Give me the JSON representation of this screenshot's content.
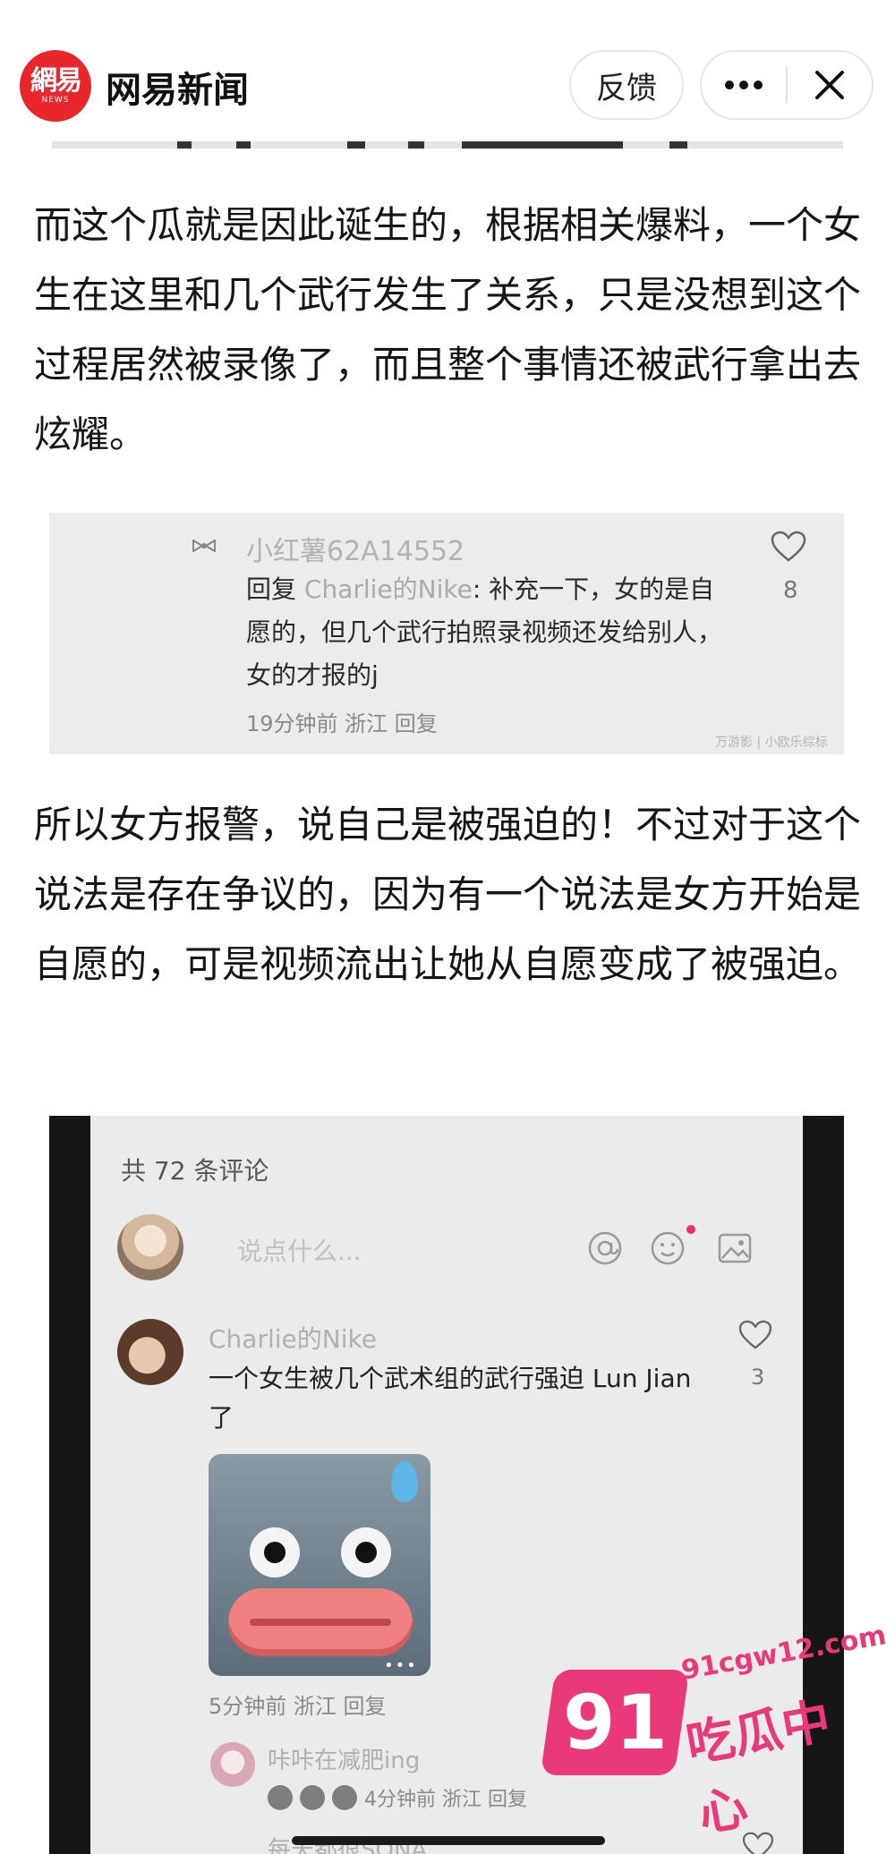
{
  "header": {
    "logo_text": "網易",
    "logo_sub": "NEWS",
    "app_title": "网易新闻",
    "feedback_label": "反馈",
    "more_icon": "more-dots-icon",
    "close_icon": "close-icon"
  },
  "article": {
    "paragraph_1": "而这个瓜就是因此诞生的，根据相关爆料，一个女生在这里和几个武行发生了关系，只是没想到这个过程居然被录像了，而且整个事情还被武行拿出去炫耀。",
    "paragraph_2": "所以女方报警，说自己是被强迫的！不过对于这个说法是存在争议的，因为有一个说法是女方开始是自愿的，可是视频流出让她从自愿变成了被强迫。"
  },
  "screenshot_reply": {
    "tie_icon": "bow-tie-icon",
    "username": "小红薯62A14552",
    "reply_prefix": "回复 ",
    "reply_to": "Charlie的Nike",
    "reply_text": ": 补充一下，女的是自愿的，但几个武行拍照录视频还发给别人，女的才报的j",
    "meta": "19分钟前 浙江 回复",
    "likes": "8",
    "watermark": "万游影 | 小欧乐综标"
  },
  "screenshot_comments": {
    "count_label": "共 72 条评论",
    "input_placeholder": "说点什么...",
    "comment": {
      "username": "Charlie的Nike",
      "text": "一个女生被几个武术组的武行强迫 Lun Jian 了",
      "likes": "3",
      "sticker_dots": "•••",
      "meta": "5分钟前 浙江 回复"
    },
    "reply": {
      "username": "咔咔在减肥ing",
      "meta": "4分钟前 浙江 回复"
    },
    "reply_2": {
      "username": "每天都很SONA"
    }
  },
  "site_watermark": {
    "badge": "91",
    "url": "91cgw12.com",
    "name": "吃瓜中心",
    "color": "#e9397a"
  }
}
